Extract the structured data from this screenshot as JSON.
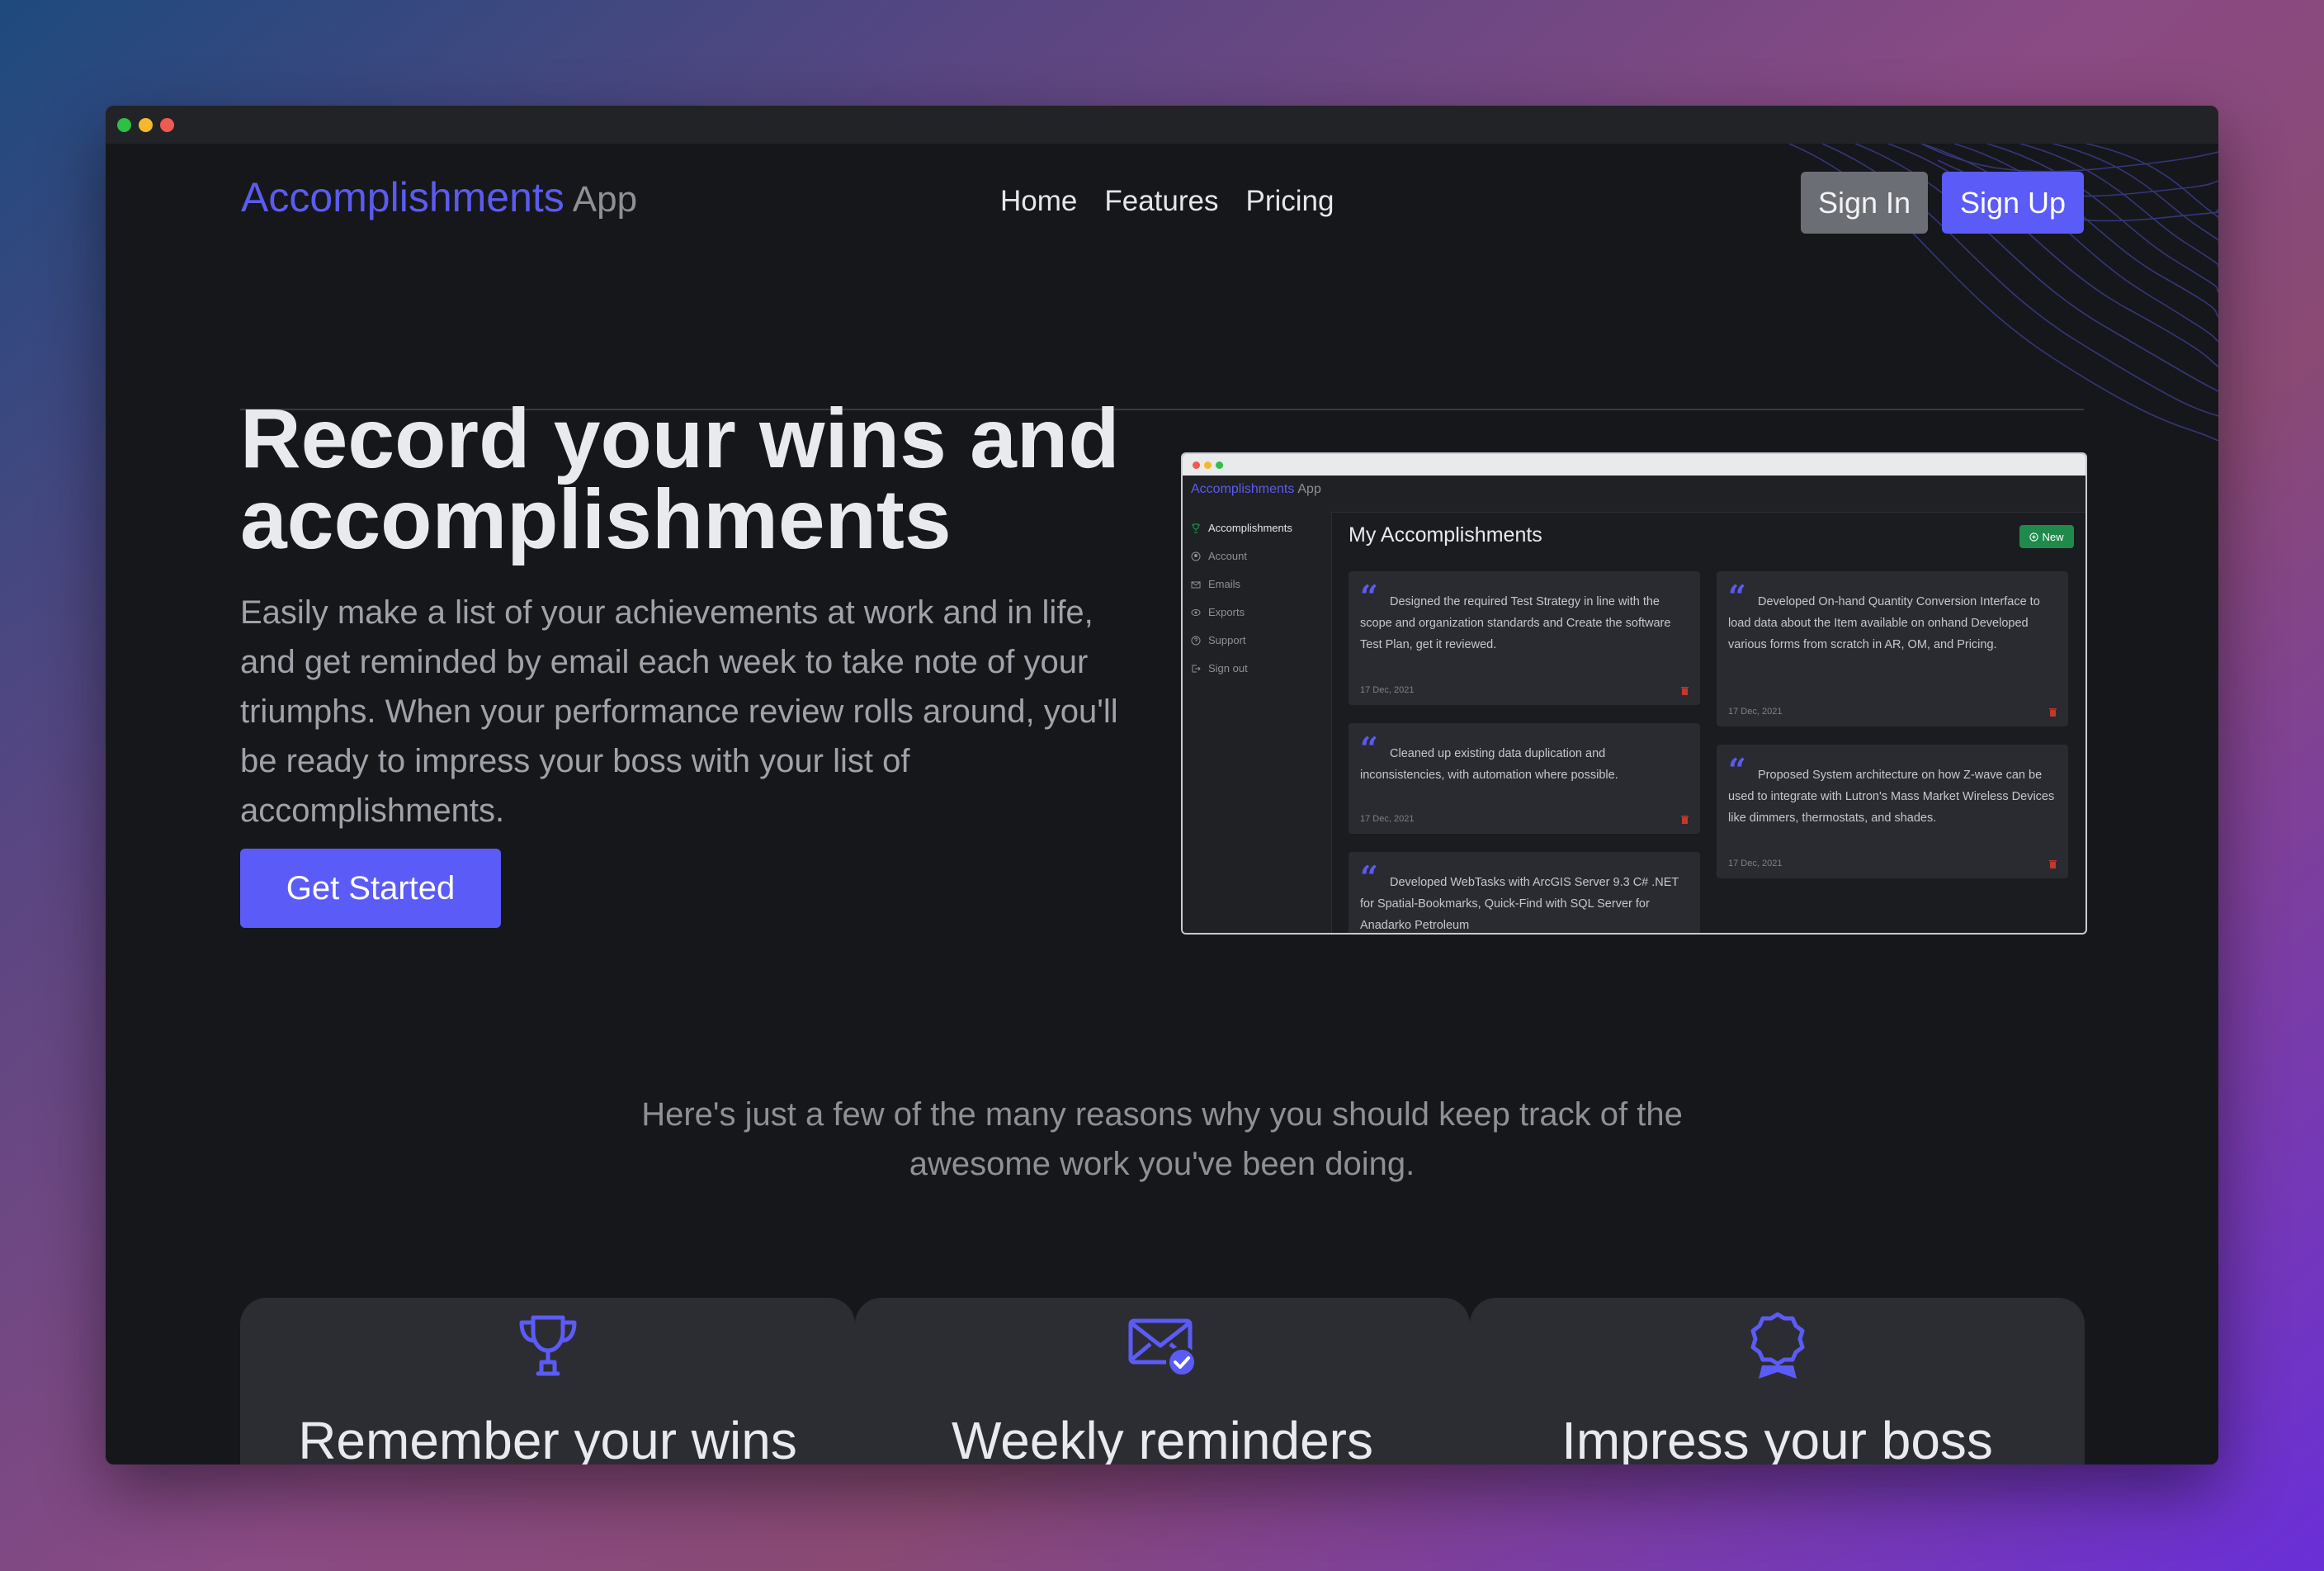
{
  "header": {
    "brand_name": "Accomplishments",
    "brand_suffix": "App",
    "nav": [
      "Home",
      "Features",
      "Pricing"
    ],
    "sign_in_label": "Sign In",
    "sign_up_label": "Sign Up"
  },
  "hero": {
    "title": "Record your wins and accomplishments",
    "text": "Easily make a list of your achievements at work and in life, and get reminded by email each week to take note of your triumphs. When your performance review rolls around, you'll be ready to impress your boss with your list of accomplishments.",
    "cta_label": "Get Started"
  },
  "preview": {
    "brand_name": "Accomplishments",
    "brand_suffix": "App",
    "sidebar": [
      {
        "label": "Accomplishments",
        "icon": "trophy-icon",
        "active": true
      },
      {
        "label": "Account",
        "icon": "user-icon",
        "active": false
      },
      {
        "label": "Emails",
        "icon": "mail-icon",
        "active": false
      },
      {
        "label": "Exports",
        "icon": "export-icon",
        "active": false
      },
      {
        "label": "Support",
        "icon": "help-icon",
        "active": false
      },
      {
        "label": "Sign out",
        "icon": "signout-icon",
        "active": false
      }
    ],
    "heading": "My Accomplishments",
    "new_label": "New",
    "cards": [
      {
        "text": "Designed the required Test Strategy in line with the scope and organization standards and Create the software Test Plan, get it reviewed.",
        "date": "17 Dec, 2021"
      },
      {
        "text": "Developed On-hand Quantity Conversion Interface to load data about the Item available on onhand Developed various forms from scratch in AR, OM, and Pricing.",
        "date": "17 Dec, 2021"
      },
      {
        "text": "Cleaned up existing data duplication and inconsistencies, with automation where possible.",
        "date": "17 Dec, 2021"
      },
      {
        "text": "Proposed System architecture on how Z-wave can be used to integrate with Lutron's Mass Market Wireless Devices like dimmers, thermostats, and shades.",
        "date": "17 Dec, 2021"
      },
      {
        "text": "Developed WebTasks with ArcGIS Server 9.3 C# .NET for Spatial-Bookmarks, Quick-Find with SQL Server for Anadarko Petroleum",
        "date": ""
      }
    ]
  },
  "reasons_text": "Here's just a few of the many reasons why you should keep track of the awesome work you've been doing.",
  "features": [
    {
      "title": "Remember your wins",
      "icon": "trophy-icon"
    },
    {
      "title": "Weekly reminders",
      "icon": "mail-check-icon"
    },
    {
      "title": "Impress your boss",
      "icon": "award-icon"
    }
  ],
  "colors": {
    "accent": "#5b5bf7",
    "background": "#16171a",
    "card": "#2c2d32",
    "new_button": "#1f8a4c"
  }
}
